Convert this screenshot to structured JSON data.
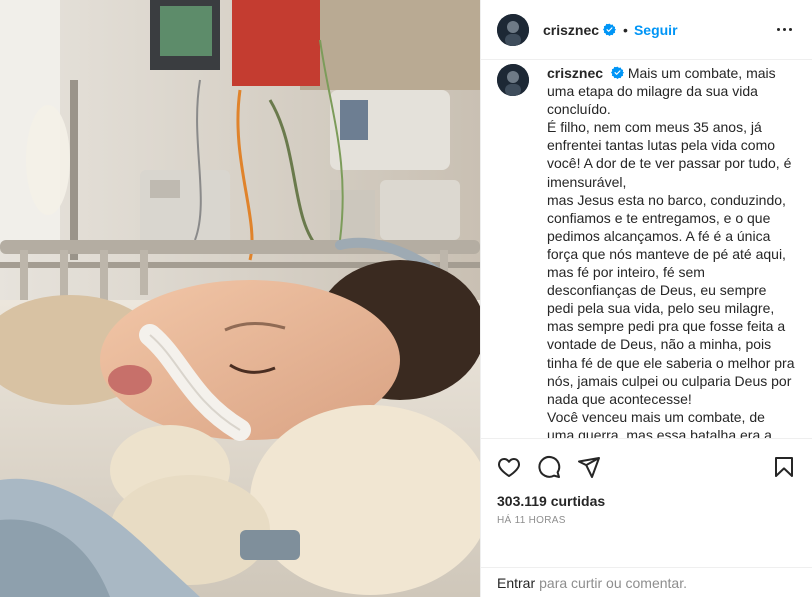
{
  "header": {
    "username": "crisznec",
    "separator": "•",
    "follow_label": "Seguir"
  },
  "caption": {
    "username": "crisznec",
    "paragraphs": [
      "Mais um combate, mais uma etapa do milagre da sua vida concluído.",
      "É filho, nem com meus 35 anos, já enfrentei tantas lutas pela vida como você! A dor de te ver passar por tudo, é imensurável,",
      "mas Jesus esta no barco, conduzindo, confiamos e te entregamos, e o que pedimos alcançamos. A fé é a única força que nós manteve de pé até aqui, mas fé por inteiro, fé sem desconfianças de Deus, eu sempre pedi pela sua vida, pelo seu milagre, mas sempre pedi pra que fosse feita a vontade de Deus, não a minha, pois tinha fé de que ele saberia o melhor pra nós, jamais culpei ou culparia Deus por nada que acontecesse!",
      "Você venceu mais um combate, de uma guerra, mas essa batalha era a mais difícil e importante e delicada,"
    ]
  },
  "actions": {
    "like_icon": "heart-icon",
    "comment_icon": "comment-icon",
    "share_icon": "share-icon",
    "save_icon": "bookmark-icon"
  },
  "likes": "303.119 curtidas",
  "time_ago": "HÁ 11 HORAS",
  "comment_bar": {
    "login_label": "Entrar",
    "prompt": "para curtir ou comentar."
  },
  "colors": {
    "accent": "#0095f6",
    "text": "#262626",
    "muted": "#8e8e8e",
    "divider": "#efefef"
  }
}
